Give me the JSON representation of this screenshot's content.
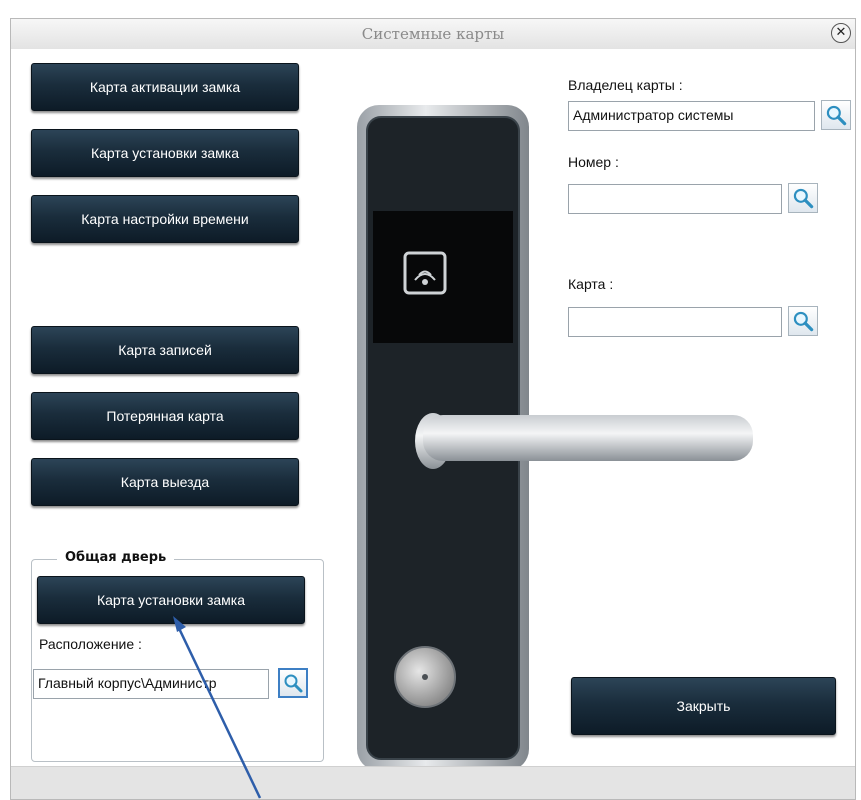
{
  "window": {
    "title": "Системные карты"
  },
  "left_buttons": [
    {
      "label": "Карта активации замка"
    },
    {
      "label": "Карта установки замка"
    },
    {
      "label": "Карта настройки времени"
    },
    {
      "label": "Карта записей"
    },
    {
      "label": "Потерянная карта"
    },
    {
      "label": "Карта выезда"
    }
  ],
  "common_door": {
    "title": "Общая дверь",
    "button_label": "Карта установки замка",
    "location_label": "Расположение :",
    "location_value": "Главный корпус\\Администр"
  },
  "right_form": {
    "owner_label": "Владелец карты :",
    "owner_value": "Администратор системы",
    "number_label": "Номер :",
    "number_value": "",
    "card_label": "Карта :",
    "card_value": ""
  },
  "close_button": {
    "label": "Закрыть"
  },
  "icons": {
    "search": "search-icon",
    "close": "close-icon"
  }
}
